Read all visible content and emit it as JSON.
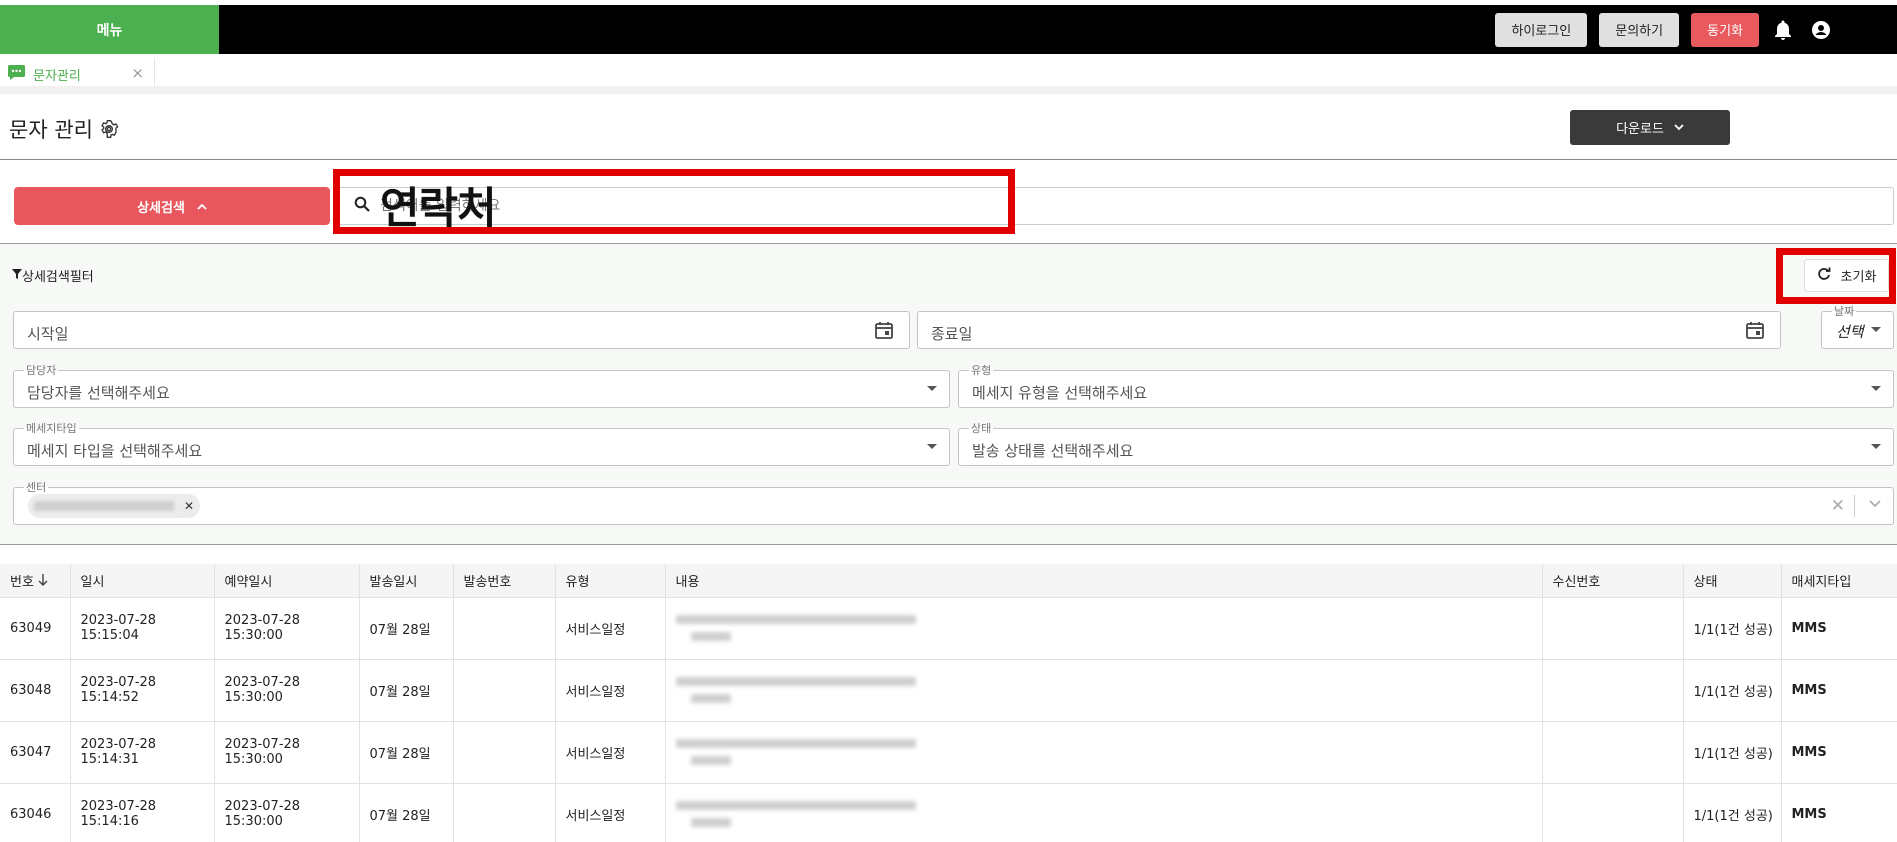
{
  "topbar": {
    "menu_label": "메뉴",
    "buttons": [
      {
        "label": "하이로그인",
        "style": "grey"
      },
      {
        "label": "문의하기",
        "style": "grey"
      },
      {
        "label": "동기화",
        "style": "red"
      }
    ],
    "icons": [
      "bell-icon",
      "account-icon"
    ]
  },
  "tab": {
    "label": "문자관리",
    "close": "×"
  },
  "page": {
    "title": "문자 관리",
    "download_label": "다운로드"
  },
  "search": {
    "detail_label": "상세검색",
    "placeholder": "검색어를 입력하세요",
    "annotation": "연락처"
  },
  "filter": {
    "title": "상세검색필터",
    "reset_label": "초기화",
    "start_date": "시작일",
    "end_date": "종료일",
    "date_type_label": "날짜",
    "date_type_value": "선택",
    "manager_label": "담당자",
    "manager_placeholder": "담당자를 선택해주세요",
    "type_label": "유형",
    "type_placeholder": "메세지 유형을 선택해주세요",
    "msgtype_label": "메세지타입",
    "msgtype_placeholder": "메세지 타입을 선택해주세요",
    "status_label": "상태",
    "status_placeholder": "발송 상태를 선택해주세요",
    "center_label": "센터"
  },
  "table": {
    "headers": [
      "번호",
      "일시",
      "예약일시",
      "발송일시",
      "발송번호",
      "유형",
      "내용",
      "수신번호",
      "상태",
      "매세지타입"
    ],
    "rows": [
      {
        "no": "63049",
        "date": "2023-07-28 15:15:04",
        "reserved": "2023-07-28 15:30:00",
        "sent": "07월 28일",
        "sender": "",
        "type": "서비스일정",
        "receiver": "",
        "status": "1/1(1건 성공)",
        "msg_type": "MMS"
      },
      {
        "no": "63048",
        "date": "2023-07-28 15:14:52",
        "reserved": "2023-07-28 15:30:00",
        "sent": "07월 28일",
        "sender": "",
        "type": "서비스일정",
        "receiver": "",
        "status": "1/1(1건 성공)",
        "msg_type": "MMS"
      },
      {
        "no": "63047",
        "date": "2023-07-28 15:14:31",
        "reserved": "2023-07-28 15:30:00",
        "sent": "07월 28일",
        "sender": "",
        "type": "서비스일정",
        "receiver": "",
        "status": "1/1(1건 성공)",
        "msg_type": "MMS"
      },
      {
        "no": "63046",
        "date": "2023-07-28 15:14:16",
        "reserved": "2023-07-28 15:30:00",
        "sent": "07월 28일",
        "sender": "",
        "type": "서비스일정",
        "receiver": "",
        "status": "1/1(1건 성공)",
        "msg_type": "MMS"
      }
    ]
  },
  "colors": {
    "brand_green": "#4caf50",
    "accent_red": "#e8575e",
    "status_green": "#43a047"
  }
}
